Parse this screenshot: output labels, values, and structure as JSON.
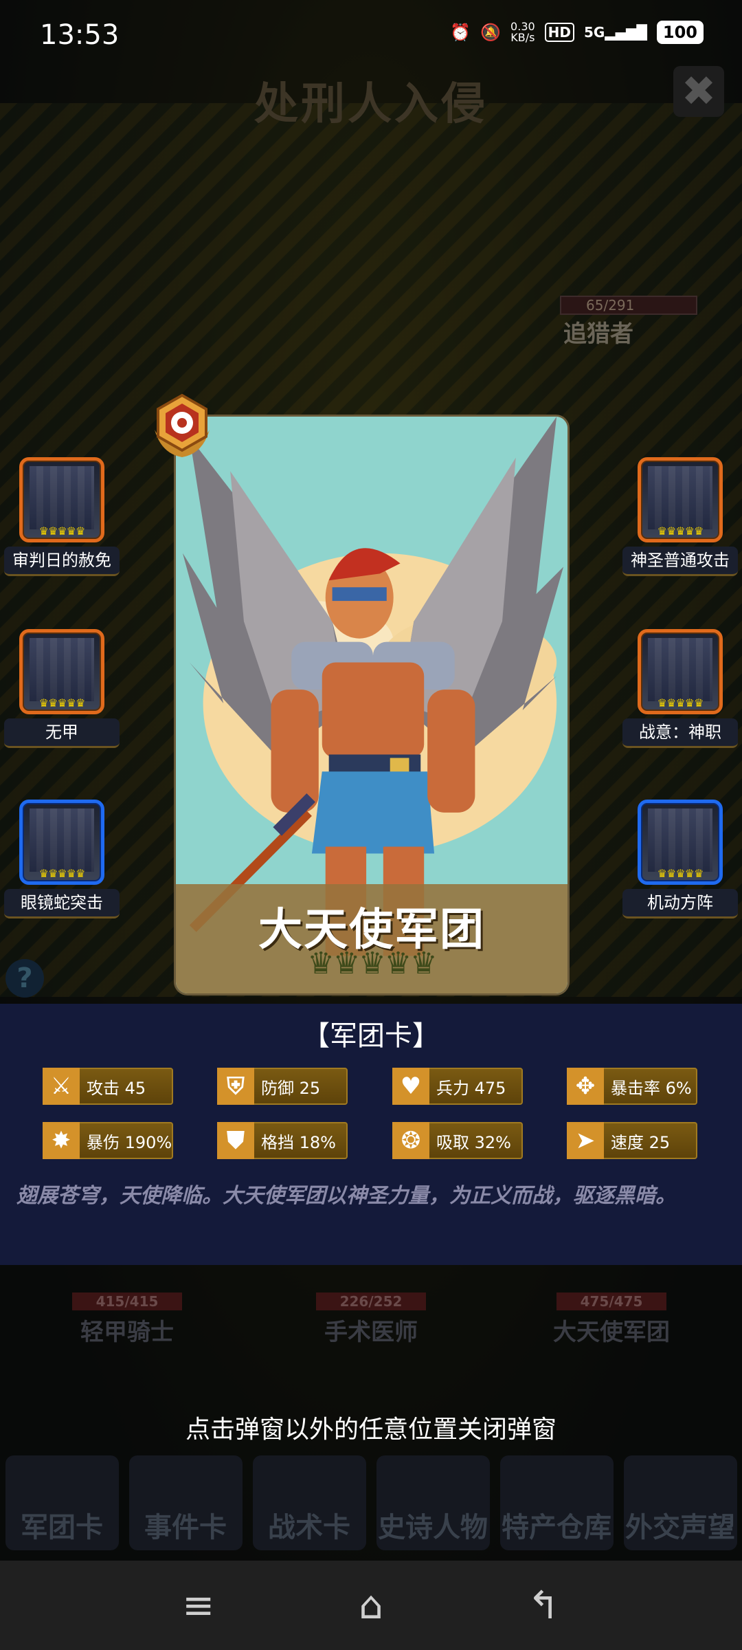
{
  "status_bar": {
    "time": "13:53",
    "net_speed_value": "0.30",
    "net_speed_unit": "KB/s",
    "hd": "HD",
    "network": "5G",
    "battery": "100"
  },
  "background": {
    "title": "处刑人入侵",
    "enemy_hp": "65/291",
    "enemy_name": "追猎者",
    "units": [
      {
        "hp": "415/415",
        "name": "轻甲骑士"
      },
      {
        "hp": "226/252",
        "name": "手术医师"
      },
      {
        "hp": "475/475",
        "name": "大天使军团"
      }
    ],
    "tabs": [
      "军团卡",
      "事件卡",
      "战术卡",
      "史诗人物",
      "特产仓库",
      "外交声望"
    ]
  },
  "skills_left": [
    {
      "label": "审判日的赦免",
      "frame": "orange"
    },
    {
      "label": "无甲",
      "frame": "orange"
    },
    {
      "label": "眼镜蛇突击",
      "frame": "blue"
    }
  ],
  "skills_right": [
    {
      "label": "神圣普通攻击",
      "frame": "orange"
    },
    {
      "label": "战意：神职",
      "frame": "orange"
    },
    {
      "label": "机动方阵",
      "frame": "blue"
    }
  ],
  "card": {
    "name": "大天使军团",
    "crowns": "♛♛♛♛♛"
  },
  "info": {
    "card_type": "【军团卡】",
    "stats": [
      {
        "icon": "sword-icon",
        "label": "攻击 45"
      },
      {
        "icon": "shield-icon",
        "label": "防御 25"
      },
      {
        "icon": "heart-icon",
        "label": "兵力 475"
      },
      {
        "icon": "crit-icon",
        "label": "暴击率 6%"
      },
      {
        "icon": "burst-icon",
        "label": "暴伤 190%"
      },
      {
        "icon": "block-icon",
        "label": "格挡 18%"
      },
      {
        "icon": "lifesteal-icon",
        "label": "吸取 32%"
      },
      {
        "icon": "boot-icon",
        "label": "速度 25"
      }
    ],
    "description": "翅展苍穹，天使降临。大天使军团以神圣力量，为正义而战，驱逐黑暗。"
  },
  "close_hint": "点击弹窗以外的任意位置关闭弹窗",
  "colors": {
    "panel": "#141a3a",
    "stat_bg": "#6b4d0e",
    "frame_orange": "#e06a1c",
    "frame_blue": "#1f6af0"
  }
}
